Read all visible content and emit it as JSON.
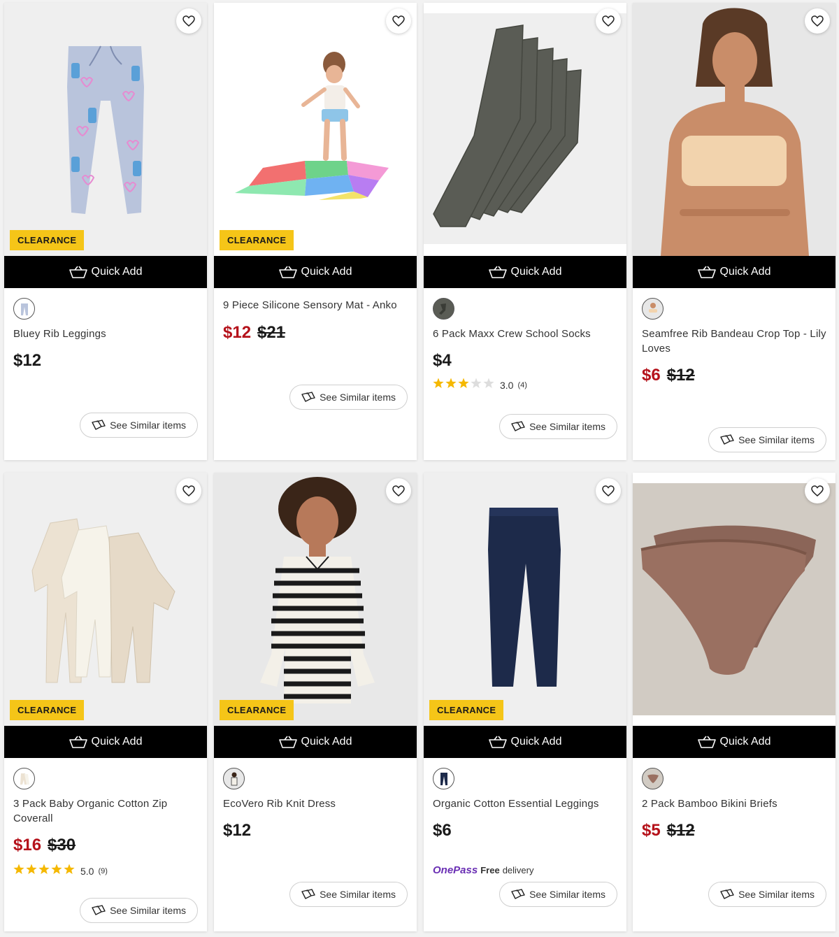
{
  "common": {
    "quick_add_label": "Quick Add",
    "see_similar_label": "See Similar items",
    "clearance_label": "CLEARANCE"
  },
  "colors": {
    "sale_price": "#b5121b",
    "badge": "#f5c518",
    "quick_add_bg": "#000000",
    "onepass": "#6a2fb4"
  },
  "products": [
    {
      "name": "Bluey Rib Leggings",
      "price": "$12",
      "was_price": "",
      "clearance": true,
      "rating": "",
      "rating_count": "",
      "swatch": "leggings-swatch"
    },
    {
      "name": "9 Piece Silicone Sensory Mat - Anko",
      "price": "$12",
      "was_price": "$21",
      "clearance": true,
      "rating": "",
      "rating_count": "",
      "swatch": ""
    },
    {
      "name": "6 Pack Maxx Crew School Socks",
      "price": "$4",
      "was_price": "",
      "clearance": false,
      "rating": "3.0",
      "rating_count": "(4)",
      "stars": 3,
      "swatch": "socks-swatch"
    },
    {
      "name": "Seamfree Rib Bandeau Crop Top - Lily Loves",
      "price": "$6",
      "was_price": "$12",
      "clearance": false,
      "rating": "",
      "rating_count": "",
      "swatch": "model-swatch"
    },
    {
      "name": "3 Pack Baby Organic Cotton Zip Coverall",
      "price": "$16",
      "was_price": "$30",
      "clearance": true,
      "rating": "5.0",
      "rating_count": "(9)",
      "stars": 5,
      "swatch": "coverall-swatch"
    },
    {
      "name": "EcoVero Rib Knit Dress",
      "price": "$12",
      "was_price": "",
      "clearance": true,
      "rating": "",
      "rating_count": "",
      "swatch": "dress-swatch"
    },
    {
      "name": "Organic Cotton Essential Leggings",
      "price": "$6",
      "was_price": "",
      "clearance": true,
      "rating": "",
      "rating_count": "",
      "swatch": "navy-leggings-swatch",
      "onepass": {
        "brand": "OnePass",
        "free": "Free",
        "text": "delivery"
      }
    },
    {
      "name": "2 Pack Bamboo Bikini Briefs",
      "price": "$5",
      "was_price": "$12",
      "clearance": false,
      "rating": "",
      "rating_count": "",
      "swatch": "briefs-swatch"
    }
  ]
}
